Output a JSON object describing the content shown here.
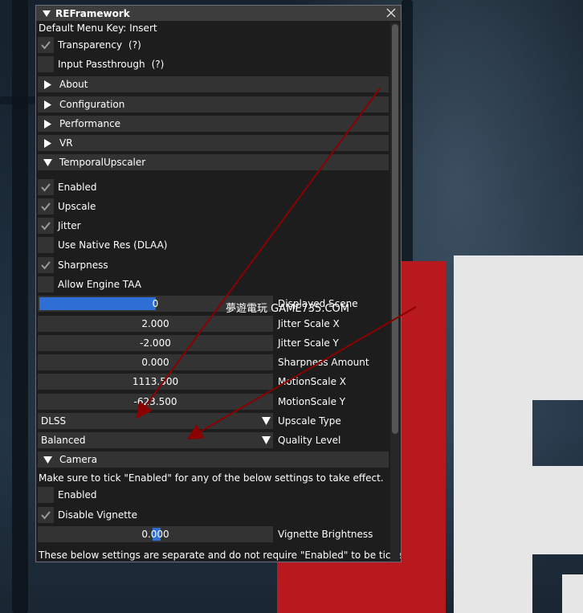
{
  "window": {
    "title": "REFramework",
    "default_key_text": "Default Menu Key: Insert",
    "transparency_label": "Transparency",
    "transparency_help": "(?)",
    "transparency_checked": true,
    "passthrough_label": "Input Passthrough",
    "passthrough_help": "(?)",
    "passthrough_checked": false
  },
  "sections": {
    "about": "About",
    "configuration": "Configuration",
    "performance": "Performance",
    "vr": "VR",
    "temporal": "TemporalUpscaler",
    "camera": "Camera"
  },
  "temporal": {
    "enabled": {
      "label": "Enabled",
      "checked": true
    },
    "upscale": {
      "label": "Upscale",
      "checked": true
    },
    "jitter": {
      "label": "Jitter",
      "checked": true
    },
    "native_res": {
      "label": "Use Native Res (DLAA)",
      "checked": false
    },
    "sharpness": {
      "label": "Sharpness",
      "checked": true
    },
    "allow_taa": {
      "label": "Allow Engine TAA",
      "checked": false
    },
    "displayed_scene": {
      "value": "0",
      "label": "Displayed Scene"
    },
    "jitter_x": {
      "value": "2.000",
      "label": "Jitter Scale X"
    },
    "jitter_y": {
      "value": "-2.000",
      "label": "Jitter Scale Y"
    },
    "sharp_amount": {
      "value": "0.000",
      "label": "Sharpness Amount"
    },
    "motion_x": {
      "value": "1113.500",
      "label": "MotionScale X"
    },
    "motion_y": {
      "value": "-623.500",
      "label": "MotionScale Y"
    },
    "upscale_type": {
      "value": "DLSS",
      "label": "Upscale Type"
    },
    "quality": {
      "value": "Balanced",
      "label": "Quality Level"
    }
  },
  "camera": {
    "note": "Make sure to tick \"Enabled\" for any of the below settings to take effect.",
    "enabled": {
      "label": "Enabled",
      "checked": false
    },
    "vignette": {
      "label": "Disable Vignette",
      "checked": true
    },
    "vignette_brightness": {
      "value": "0.000",
      "label": "Vignette Brightness"
    },
    "footer_note": "These below settings are separate and do not require \"Enabled\" to be ticked."
  },
  "watermark": "夢遊電玩 GAME735.COM",
  "colors": {
    "accent": "#2e6fd6",
    "frame": "#333333",
    "window_bg": "#1d1d1d",
    "annotation": "#8b0000"
  }
}
